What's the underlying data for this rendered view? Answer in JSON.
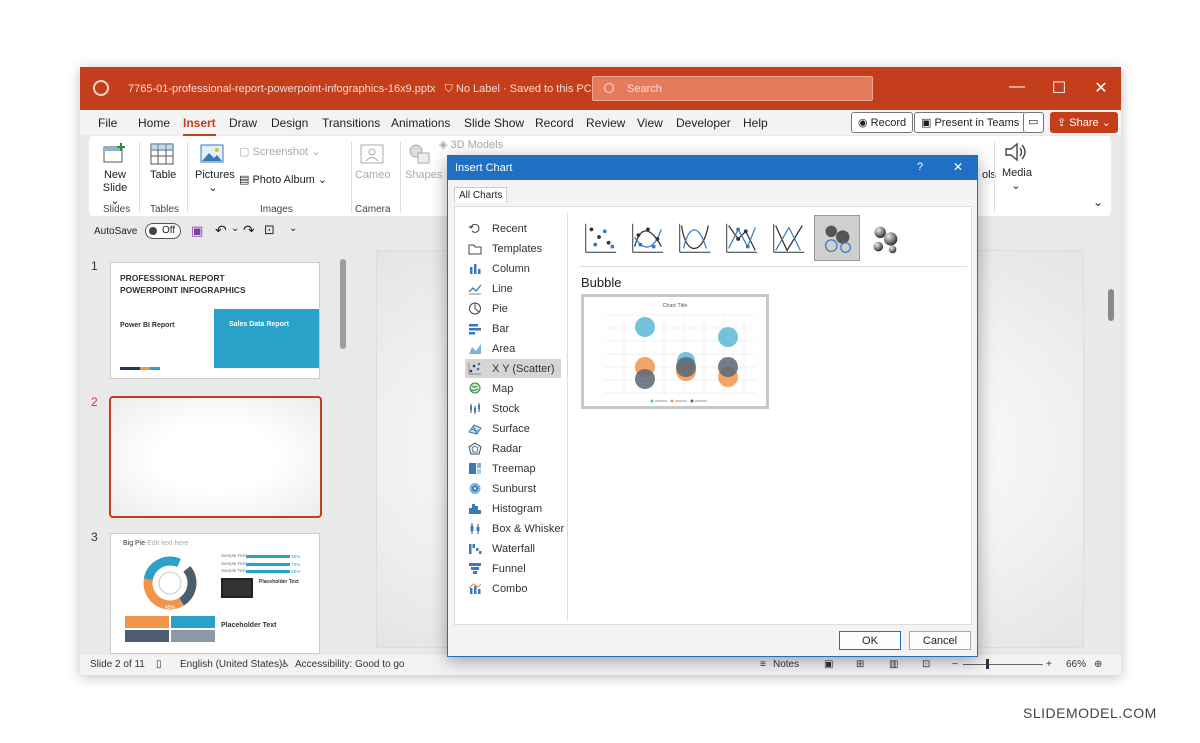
{
  "window": {
    "doc_title": "7765-01-professional-report-powerpoint-infographics-16x9.pptx",
    "label_status": "No Label",
    "save_status": "Saved to this PC",
    "search_placeholder": "Search"
  },
  "menu": {
    "items": [
      "File",
      "Home",
      "Insert",
      "Draw",
      "Design",
      "Transitions",
      "Animations",
      "Slide Show",
      "Record",
      "Review",
      "View",
      "Developer",
      "Help"
    ],
    "active": "Insert",
    "record_label": "Record",
    "present_label": "Present in Teams",
    "share_label": "Share"
  },
  "ribbon": {
    "new_slide": "New Slide",
    "slides_group": "Slides",
    "table": "Table",
    "tables_group": "Tables",
    "pictures": "Pictures",
    "screenshot": "Screenshot",
    "photo_album": "Photo Album",
    "images_group": "Images",
    "cameo": "Cameo",
    "camera_group": "Camera",
    "shapes": "Shapes",
    "models_3d": "3D Models",
    "media": "Media",
    "symbols_partial": "ols"
  },
  "qat": {
    "autosave_label": "AutoSave",
    "autosave_state": "Off"
  },
  "slides": {
    "thumb1_title_line1": "PROFESSIONAL REPORT",
    "thumb1_title_line2": "POWERPOINT INFOGRAPHICS",
    "thumb1_subtitle": "Power BI Report",
    "thumb1_box_text": "Sales Data Report",
    "thumb3_title": "Big Pie",
    "thumb3_title_hint": "Edit text here",
    "thumb3_placeholder_text": "Placeholder Text",
    "thumb3_sample_text": "Sample Text",
    "thumb3_pct_1": "90%",
    "thumb3_pct_2": "70%",
    "thumb3_pct_3": "60%",
    "thumb3_pie_pct": "45%",
    "numbers": [
      "1",
      "2",
      "3"
    ]
  },
  "status": {
    "slide_info": "Slide 2 of 11",
    "language": "English (United States)",
    "accessibility": "Accessibility: Good to go",
    "notes": "Notes",
    "zoom": "66%"
  },
  "dialog": {
    "title": "Insert Chart",
    "help": "?",
    "close": "✕",
    "tab": "All Charts",
    "categories": [
      "Recent",
      "Templates",
      "Column",
      "Line",
      "Pie",
      "Bar",
      "Area",
      "X Y (Scatter)",
      "Map",
      "Stock",
      "Surface",
      "Radar",
      "Treemap",
      "Sunburst",
      "Histogram",
      "Box & Whisker",
      "Waterfall",
      "Funnel",
      "Combo"
    ],
    "active_category": "X Y (Scatter)",
    "chart_type_heading": "Bubble",
    "preview_title": "Chart Title",
    "ok": "OK",
    "cancel": "Cancel"
  },
  "colors": {
    "accent": "#c43e1c",
    "dialog_blue": "#1f6fc4",
    "series1": "#5bb8d6",
    "series2": "#f0954a",
    "series3": "#5a6677"
  },
  "brand": "SLIDEMODEL.COM"
}
